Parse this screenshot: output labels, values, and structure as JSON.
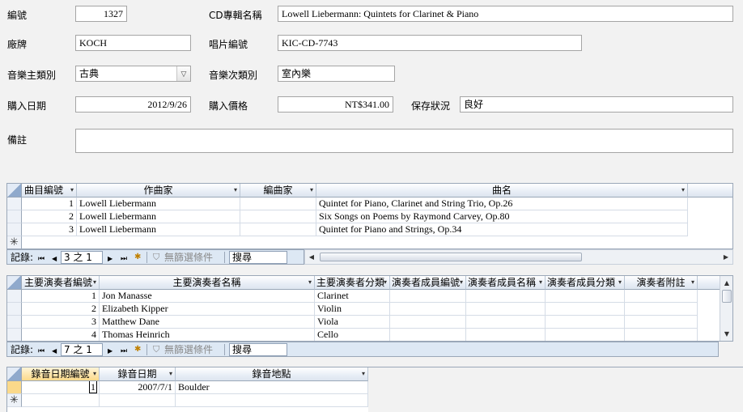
{
  "form": {
    "id_label": "編號",
    "id_value": "1327",
    "album_label": "CD專輯名稱",
    "album_value": "Lowell Liebermann: Quintets for Clarinet & Piano",
    "label_label": "廠牌",
    "label_value": "KOCH",
    "catalog_label": "唱片編號",
    "catalog_value": "KIC-CD-7743",
    "genre_label": "音樂主類別",
    "genre_value": "古典",
    "subgenre_label": "音樂次類別",
    "subgenre_value": "室內樂",
    "date_label": "購入日期",
    "date_value": "2012/9/26",
    "price_label": "購入價格",
    "price_value": "NT$341.00",
    "condition_label": "保存狀況",
    "condition_value": "良好",
    "notes_label": "備註",
    "notes_value": ""
  },
  "tracks": {
    "columns": [
      "曲目編號",
      "作曲家",
      "編曲家",
      "曲名"
    ],
    "rows": [
      {
        "no": "1",
        "composer": "Lowell Liebermann",
        "arranger": "",
        "title": "Quintet for Piano, Clarinet and String Trio, Op.26"
      },
      {
        "no": "2",
        "composer": "Lowell Liebermann",
        "arranger": "",
        "title": "Six Songs on Poems by Raymond Carvey, Op.80"
      },
      {
        "no": "3",
        "composer": "Lowell Liebermann",
        "arranger": "",
        "title": "Quintet for Piano and Strings, Op.34"
      }
    ],
    "nav": {
      "record_label": "記錄:",
      "position": "3 之 1",
      "filter_label": "無篩選條件",
      "search_label": "搜尋"
    }
  },
  "performers": {
    "columns": [
      "主要演奏者編號",
      "主要演奏者名稱",
      "主要演奏者分類",
      "演奏者成員編號",
      "演奏者成員名稱",
      "演奏者成員分類",
      "演奏者附註"
    ],
    "rows": [
      {
        "no": "1",
        "name": "Jon Manasse",
        "type": "Clarinet"
      },
      {
        "no": "2",
        "name": "Elizabeth Kipper",
        "type": "Violin"
      },
      {
        "no": "3",
        "name": "Matthew Dane",
        "type": "Viola"
      },
      {
        "no": "4",
        "name": "Thomas Heinrich",
        "type": "Cello"
      }
    ],
    "nav": {
      "record_label": "記錄:",
      "position": "7 之 1",
      "filter_label": "無篩選條件",
      "search_label": "搜尋"
    }
  },
  "recording": {
    "columns": [
      "錄音日期編號",
      "錄音日期",
      "錄音地點"
    ],
    "rows": [
      {
        "no": "1",
        "date": "2007/7/1",
        "place": "Boulder"
      }
    ]
  },
  "icons": {
    "dropdown": "▾",
    "combo": "▽",
    "first": "⏮",
    "prev": "◀",
    "next": "▶",
    "last": "⏭",
    "new": "✱",
    "filter": "⛉",
    "new_row": "✳",
    "scroll_up": "▲",
    "scroll_down": "▼",
    "scroll_left": "◀",
    "scroll_right": "▶"
  },
  "colors": {
    "header_bg": "#dde5ef",
    "nav_bg": "#dde8f4",
    "border": "#9aa7b8"
  }
}
